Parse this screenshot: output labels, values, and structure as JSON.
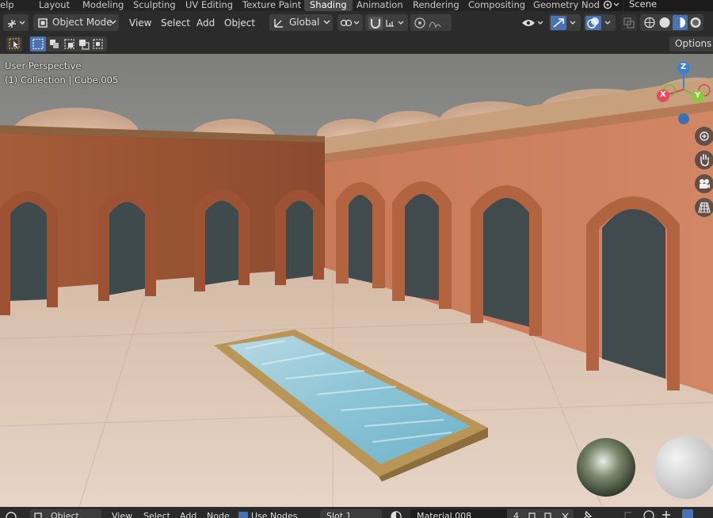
{
  "menu": {
    "help_partial": "elp"
  },
  "workspaces": {
    "tabs": [
      {
        "label": "Layout"
      },
      {
        "label": "Modeling"
      },
      {
        "label": "Sculpting"
      },
      {
        "label": "UV Editing"
      },
      {
        "label": "Texture Paint"
      },
      {
        "label": "Shading"
      },
      {
        "label": "Animation"
      },
      {
        "label": "Rendering"
      },
      {
        "label": "Compositing"
      },
      {
        "label": "Geometry Nod"
      }
    ],
    "active": "Shading",
    "scene_label": "Scene"
  },
  "header": {
    "mode": "Object Mode",
    "menus": [
      "View",
      "Select",
      "Add",
      "Object"
    ],
    "transform_orientation": "Global"
  },
  "toolbar": {
    "options_label": "Options"
  },
  "viewport": {
    "view_name": "User Perspective",
    "collection_info": "(1) Collection | Cube.005",
    "gizmo": {
      "z": "Z",
      "x": "X",
      "y": "Y"
    }
  },
  "bottombar": {
    "mode": "Object",
    "menus": [
      "View",
      "Select",
      "Add",
      "Node"
    ],
    "use_nodes": "Use Nodes",
    "slot": "Slot 1",
    "material": "Material.008",
    "user_count": "4"
  },
  "colors": {
    "accent": "#4772b3",
    "header": "#2b2b2b",
    "active_tab": "#474747"
  }
}
